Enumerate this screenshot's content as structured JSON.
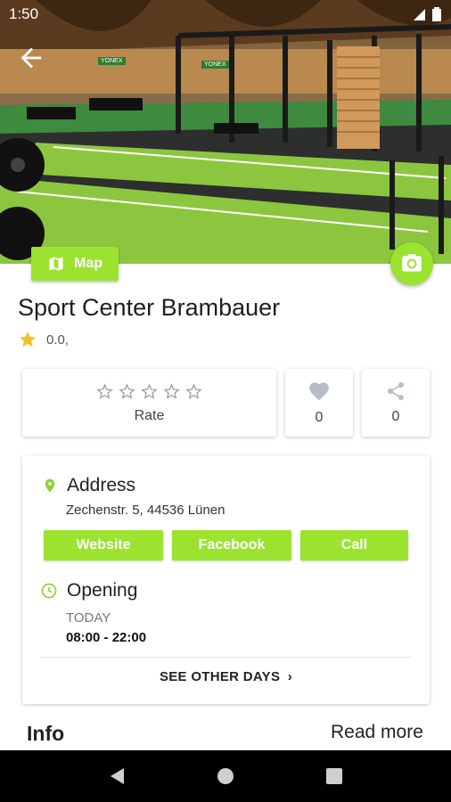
{
  "status_bar": {
    "time": "1:50"
  },
  "hero": {
    "signs": [
      "YONEX",
      "YONEX"
    ]
  },
  "map_button": {
    "label": "Map"
  },
  "place": {
    "name": "Sport Center Brambauer",
    "rating": "0.0,"
  },
  "rate": {
    "label": "Rate",
    "stars": 5
  },
  "likes": {
    "count": "0"
  },
  "shares": {
    "count": "0"
  },
  "address": {
    "heading": "Address",
    "text": "Zechenstr. 5, 44536  Lünen"
  },
  "actions": {
    "website": "Website",
    "facebook": "Facebook",
    "call": "Call"
  },
  "opening": {
    "heading": "Opening",
    "day_label": "TODAY",
    "hours": "08:00 - 22:00",
    "see_other_days": "SEE OTHER DAYS"
  },
  "info": {
    "title": "Info",
    "read_more": "Read more"
  },
  "colors": {
    "accent": "#9be32f",
    "star": "#f6c02c"
  }
}
